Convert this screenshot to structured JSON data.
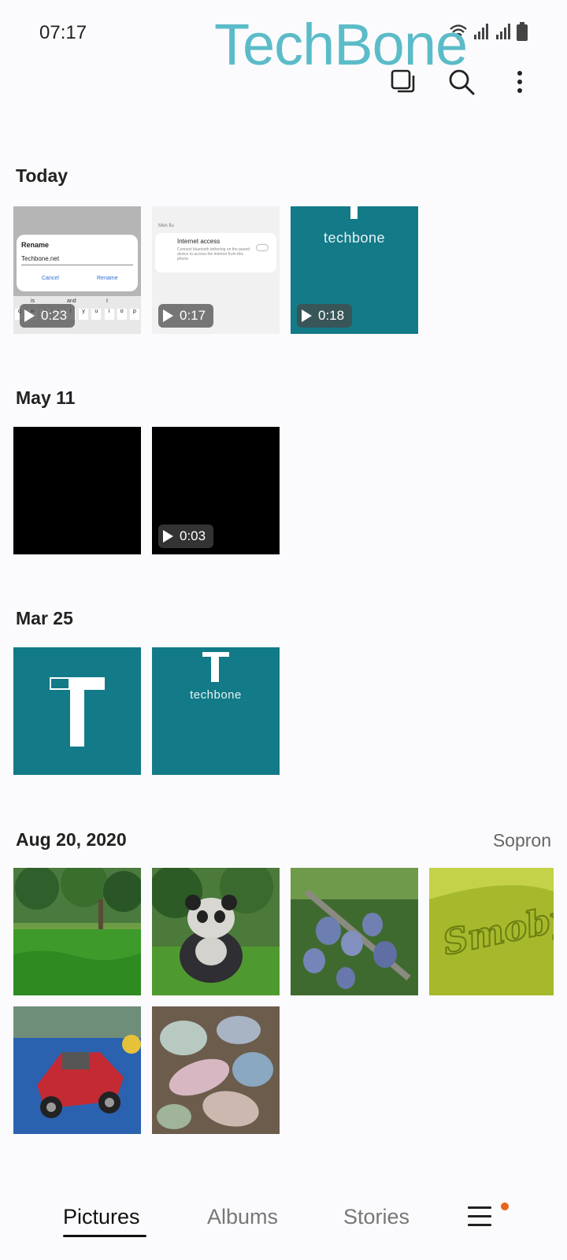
{
  "status_bar": {
    "time": "07:17"
  },
  "watermark": "TechBone",
  "toolbar": {
    "icons": [
      "select-icon",
      "search-icon",
      "more-options-icon"
    ]
  },
  "sections": [
    {
      "title": "Today",
      "location": "",
      "items": [
        {
          "kind": "video",
          "duration": "0:23",
          "preview": {
            "dialog_title": "Rename",
            "field_value": "Techbone.net",
            "cancel": "Cancel",
            "confirm": "Rename",
            "kb_words": [
              "is",
              "and",
              "I"
            ],
            "kb_keys": [
              "q",
              "w",
              "e",
              "r",
              "t",
              "y",
              "u",
              "i",
              "o",
              "p"
            ]
          }
        },
        {
          "kind": "video",
          "duration": "0:17",
          "preview": {
            "header": "Mon fiu",
            "title": "Internet access",
            "desc": "Connect bluetooth tethering on the paired device to access the internet from this phone."
          }
        },
        {
          "kind": "video",
          "duration": "0:18",
          "preview": {
            "word": "techbone"
          }
        }
      ]
    },
    {
      "title": "May 11",
      "location": "",
      "items": [
        {
          "kind": "image"
        },
        {
          "kind": "video",
          "duration": "0:03"
        }
      ]
    },
    {
      "title": "Mar 25",
      "location": "",
      "items": [
        {
          "kind": "image",
          "preview": {
            "letter": "T"
          }
        },
        {
          "kind": "image",
          "preview": {
            "letter": "T",
            "word": "techbone"
          }
        }
      ]
    },
    {
      "title": "Aug 20, 2020",
      "location": "Sopron",
      "items": [
        {
          "kind": "image",
          "subject": "grass-photo"
        },
        {
          "kind": "image",
          "subject": "panda-photo"
        },
        {
          "kind": "image",
          "subject": "plums-photo"
        },
        {
          "kind": "image",
          "subject": "smoby-photo",
          "preview": {
            "word": "Smoby"
          }
        },
        {
          "kind": "image",
          "subject": "toy-car-photo"
        },
        {
          "kind": "image",
          "subject": "chalk-photo"
        }
      ]
    }
  ],
  "bottom_nav": {
    "tabs": [
      {
        "label": "Pictures",
        "active": true
      },
      {
        "label": "Albums",
        "active": false
      },
      {
        "label": "Stories",
        "active": false
      }
    ],
    "menu_icon": "hamburger-menu-icon",
    "notification_color": "#e8651a"
  }
}
